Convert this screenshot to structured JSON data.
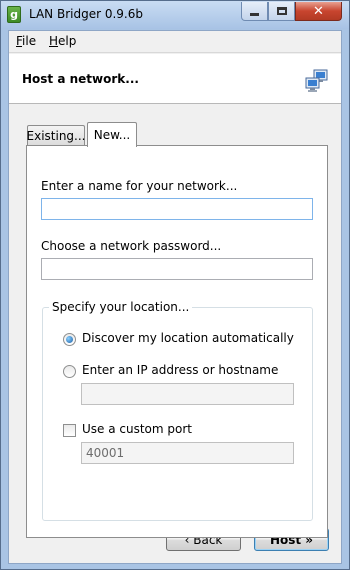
{
  "window": {
    "title": "LAN Bridger 0.9.6b",
    "app_icon_glyph": "g",
    "controls": {
      "close_glyph": "✕"
    }
  },
  "menu": {
    "items": [
      {
        "accel": "F",
        "rest": "ile"
      },
      {
        "accel": "H",
        "rest": "elp"
      }
    ]
  },
  "header": {
    "title": "Host a network...",
    "icon": "network-computers-icon"
  },
  "tabs": [
    {
      "label": "Existing...",
      "selected": false
    },
    {
      "label": "New...",
      "selected": true
    }
  ],
  "form": {
    "name_label": "Enter a name for your network...",
    "name_value": "",
    "password_label": "Choose a network password...",
    "password_value": "",
    "location_group_label": "Specify your location...",
    "location_options": [
      {
        "label": "Discover my location automatically",
        "checked": true
      },
      {
        "label": "Enter an IP address or hostname",
        "checked": false
      }
    ],
    "ip_value": "",
    "custom_port_label": "Use a custom port",
    "custom_port_checked": false,
    "port_value": "40001"
  },
  "buttons": {
    "back": "‹ Back",
    "host": "Host »"
  }
}
